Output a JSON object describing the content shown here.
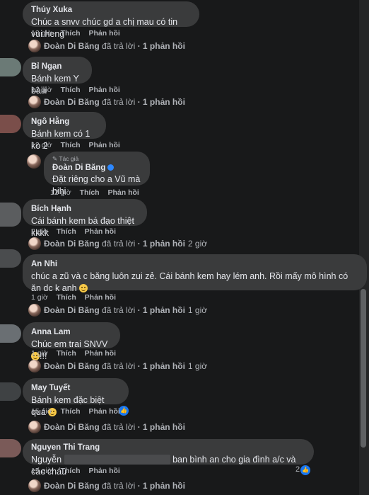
{
  "replies": {
    "author": "Đoàn Di Băng",
    "suffix": "đã trả lời",
    "count": "1 phản hồi"
  },
  "actions": {
    "like": "Thích",
    "reply": "Phản hồi"
  },
  "comments": [
    {
      "author": "Thúy Xuka",
      "text": "Chúc a snvv chúc gd a chị mau có tin vui heng",
      "time": "13 giờ",
      "reply_time": ""
    },
    {
      "author": "Bỉ Ngạn",
      "text": "Bánh kem Y bàiii",
      "time": "12 giờ",
      "reply_time": ""
    },
    {
      "author": "Ngô Hằng",
      "text": "Bánh kem có 1 ko 2",
      "time": "12 giờ",
      "reply_time": ""
    },
    {
      "author": "Bích Hạnh",
      "text": "Cái bánh kem bá đạo thiệt kkkk",
      "time": "2 giờ",
      "reply_time": "2 giờ"
    },
    {
      "author": "An Nhi",
      "text": "chúc a zũ và c băng luôn zui zẻ. Cái bánh kem hay lém anh. Rồi mấy mô hình có ăn dc k anh",
      "time": "1 giờ",
      "reply_time": "1 giờ"
    },
    {
      "author": "Anna Lam",
      "text": "Chúc em trai SNVV",
      "text_suffix": "!!!",
      "time": "1 giờ",
      "reply_time": "1 giờ"
    },
    {
      "author": "May Tuyết",
      "text": "Bánh kem đặc biệt quá",
      "time": "15 giờ",
      "reply_time": ""
    },
    {
      "author": "Nguyen Thi Trang",
      "text_start": "Nguyễn",
      "text_end": "ban bình an cho gia đình a/c và các cháu",
      "time": "15 giờ",
      "reply_time": "",
      "like_count": "2"
    }
  ],
  "author_reply": {
    "badge": "Tác giả",
    "author": "Đoàn Di Băng",
    "text": "Đặt riêng cho a Vũ mà hihi",
    "time": "12 giờ"
  }
}
